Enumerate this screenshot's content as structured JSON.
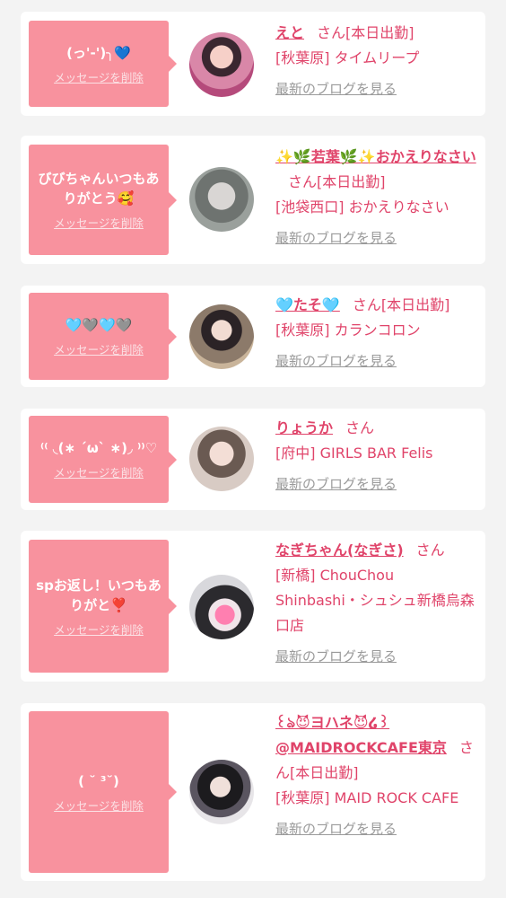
{
  "common": {
    "delete_label": "メッセージを削除",
    "san_label": "さん",
    "blog_label": "最新のブログを見る"
  },
  "items": [
    {
      "message": "(っ'-')╮💙",
      "name": "えと",
      "status": "[本日出勤]",
      "area": "[秋葉原]",
      "shop": "タイムリープ"
    },
    {
      "message": "びびちゃんいつもありがとう🥰",
      "name": "✨🌿若葉🌿✨おかえりなさい",
      "status": "[本日出勤]",
      "area": "[池袋西口]",
      "shop": "おかえりなさい"
    },
    {
      "message": "🩵🩶🩵🩶",
      "name": "🩵たそ🩵",
      "status": "[本日出勤]",
      "area": "[秋葉原]",
      "shop": "カランコロン"
    },
    {
      "message": "⁽⁽ ◟(∗ ˊωˋ ∗)◞ ⁾⁾♡",
      "name": "りょうか",
      "status": "",
      "area": "[府中]",
      "shop": "GIRLS BAR Felis"
    },
    {
      "message": "spお返し！いつもありがと❣️",
      "name": "なぎちゃん(なぎさ)",
      "status": "",
      "area": "[新橋]",
      "shop": "ChouChou Shinbashi・シュシュ新橋烏森口店"
    },
    {
      "message": "( ˘ ³˘)",
      "name": "꒰ঌ😈ヨハネ😈໒꒱ @MAIDROCKCAFE東京",
      "status": "[本日出勤]",
      "area": "[秋葉原]",
      "shop": "MAID ROCK CAFE"
    }
  ]
}
